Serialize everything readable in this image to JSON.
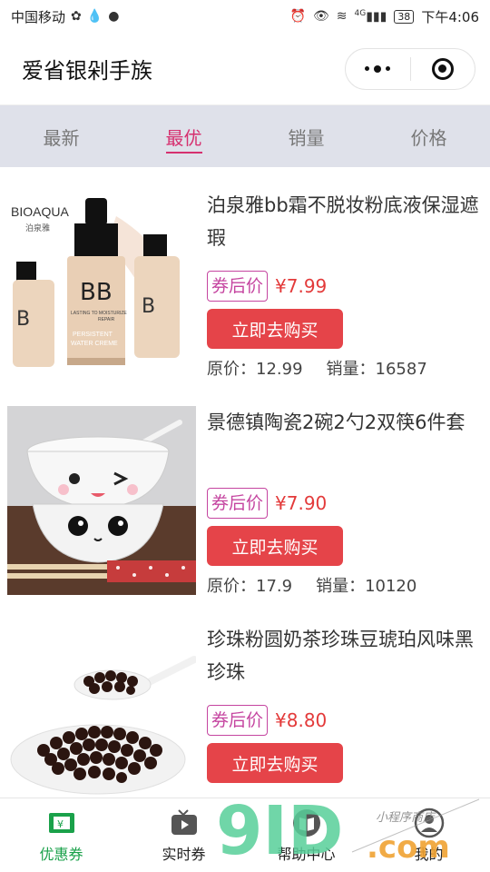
{
  "status_bar": {
    "carrier": "中国移动",
    "network": "4G",
    "battery": "38",
    "time": "下午4:06"
  },
  "header": {
    "title": "爱省银剁手族"
  },
  "tabs": [
    {
      "label": "最新",
      "active": false
    },
    {
      "label": "最优",
      "active": true
    },
    {
      "label": "销量",
      "active": false
    },
    {
      "label": "价格",
      "active": false
    }
  ],
  "products": [
    {
      "name": "泊泉雅bb霜不脱妆粉底液保湿遮瑕",
      "coupon_label": "券后价",
      "price": "¥7.99",
      "buy_label": "立即去购买",
      "original_price": "原价：12.99",
      "sales": "销量：16587",
      "image_text": {
        "brand": "BIOAQUA",
        "brand_cn": "泊泉雅",
        "bb": "BB",
        "sub1": "LASTING TO MOISTURIZE",
        "sub2": "REPAIR",
        "sub3": "PERSISTENT",
        "sub4": "WATER CREME"
      }
    },
    {
      "name": "景德镇陶瓷2碗2勺2双筷6件套",
      "coupon_label": "券后价",
      "price": "¥7.90",
      "buy_label": "立即去购买",
      "original_price": "原价：17.9",
      "sales": "销量：10120"
    },
    {
      "name": "珍珠粉圆奶茶珍珠豆琥珀风味黑珍珠",
      "coupon_label": "券后价",
      "price": "¥8.80",
      "buy_label": "立即去购买"
    }
  ],
  "tabbar": [
    {
      "label": "优惠券",
      "icon": "coupon-icon",
      "active": true
    },
    {
      "label": "实时券",
      "icon": "tv-play-icon",
      "active": false
    },
    {
      "label": "帮助中心",
      "icon": "book-icon",
      "active": false
    },
    {
      "label": "我的",
      "icon": "user-icon",
      "active": false
    }
  ],
  "watermark": {
    "logo": "9ID",
    "suffix": ".com",
    "tagline": "小程序商店"
  },
  "colors": {
    "accent": "#d6306f",
    "buy_button": "#e54449",
    "price": "#e33a3a",
    "coupon_border": "#c545a0",
    "tab_bg": "#dfe1ea",
    "tabbar_active": "#1aa14a"
  }
}
